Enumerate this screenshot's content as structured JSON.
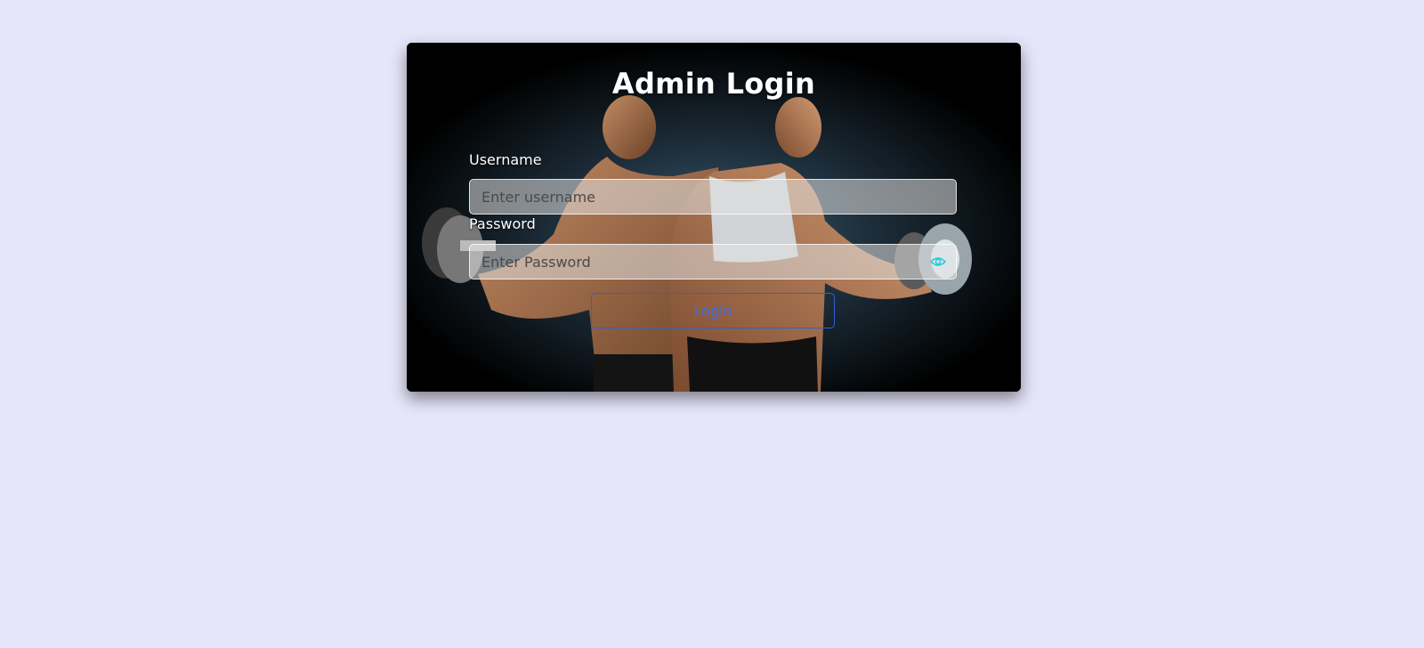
{
  "login": {
    "title": "Admin Login",
    "username_label": "Username",
    "username_placeholder": "Enter username",
    "username_value": "",
    "password_label": "Password",
    "password_placeholder": "Enter Password",
    "password_value": "",
    "toggle_icon": "eye-icon",
    "submit_label": "Login"
  },
  "colors": {
    "page_background": "#e6e6fa",
    "button_border": "#2f5fd6",
    "button_text": "#3b6cf0",
    "toggle_icon": "#1ec8d8"
  },
  "background_image": "fitness-couple-with-dumbbells-photo"
}
